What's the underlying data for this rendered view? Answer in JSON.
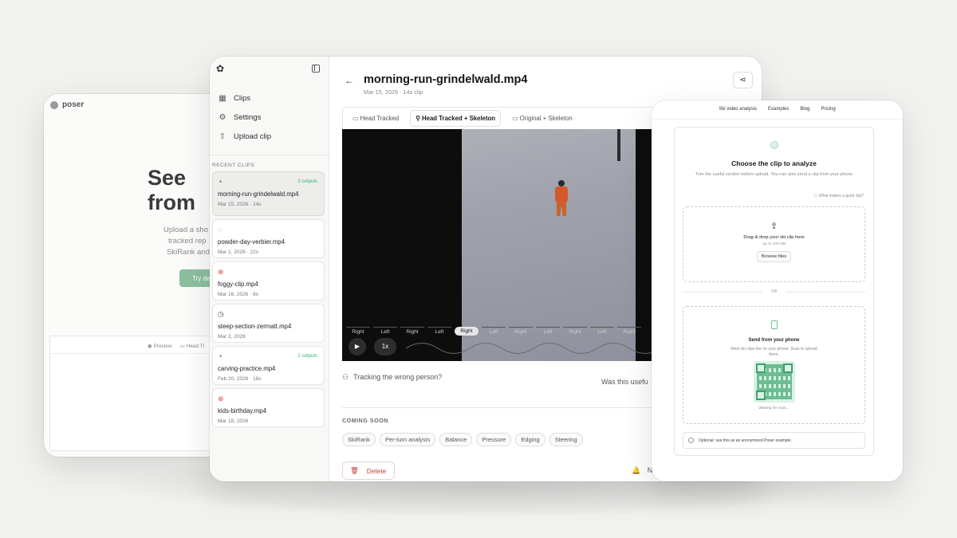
{
  "back_page": {
    "brand": "poser",
    "hero_line1": "See",
    "hero_line2": "from",
    "sub_line1": "Upload a sho",
    "sub_line2": "tracked rep",
    "sub_line3": "SkiRank and",
    "cta": "Try de",
    "preview_tab1": "Preview",
    "preview_tab2": "Head Tr"
  },
  "sidebar": {
    "nav": [
      {
        "label": "Clips",
        "icon": "grid-icon"
      },
      {
        "label": "Settings",
        "icon": "gear-icon"
      },
      {
        "label": "Upload clip",
        "icon": "upload-icon"
      }
    ],
    "recent_title": "RECENT CLIPS",
    "clips": [
      {
        "name": "morning-run-grindelwald.mp4",
        "meta": "Mar 15, 2026 · 14s",
        "status": "done",
        "badge": "3 outputs"
      },
      {
        "name": "powder-day-verbier.mp4",
        "meta": "Mar 1, 2026 · 22s",
        "status": "loading",
        "badge": ""
      },
      {
        "name": "foggy-clip.mp4",
        "meta": "Mar 16, 2026 · 8s",
        "status": "error",
        "badge": ""
      },
      {
        "name": "steep-section-zermatt.mp4",
        "meta": "Mar 2, 2026",
        "status": "pending",
        "badge": ""
      },
      {
        "name": "carving-practice.mp4",
        "meta": "Feb 20, 2026 · 18s",
        "status": "done",
        "badge": "2 outputs"
      },
      {
        "name": "kids-birthday.mp4",
        "meta": "Mar 18, 2026",
        "status": "error",
        "badge": ""
      }
    ]
  },
  "main": {
    "title": "morning-run-grindelwald.mp4",
    "subtitle": "Mar 15, 2026 · 14s clip",
    "tabs": [
      "Head Tracked",
      "Head Tracked + Skeleton",
      "Original + Skeleton"
    ],
    "active_tab": 1,
    "timeline": [
      "Right",
      "Left",
      "Right",
      "Left",
      "Right",
      "Left",
      "Right",
      "Left",
      "Right",
      "Left",
      "Right"
    ],
    "active_tick": 4,
    "speed": "1x",
    "tracking_wrong": "Tracking the wrong person?",
    "was_useful": "Was this usefu",
    "coming_soon_title": "COMING SOON",
    "coming_soon": [
      "SkiRank",
      "Per-turn analysis",
      "Balance",
      "Pressure",
      "Edging",
      "Steering"
    ],
    "delete": "Delete",
    "notify": "N"
  },
  "upload_page": {
    "nav": [
      "Ski video analysis",
      "Examples",
      "Blog",
      "Pricing"
    ],
    "title": "Choose the clip to analyze",
    "desc": "Trim the useful section before upload. You can also send a clip from your phone.",
    "help": "What makes a good clip?",
    "drop_title": "Drag & drop your ski clip here",
    "drop_limit": "Up to 200 MB",
    "browse": "Browse files",
    "or": "OR",
    "phone_title": "Send from your phone",
    "phone_desc": "Most ski clips live on your phone. Scan to upload there.",
    "waiting": "Waiting for scan...",
    "optional": "Optional: use this as an anonymized Poser example."
  },
  "colors": {
    "accent": "#3ab37a",
    "error": "#d9534f",
    "background": "#f1f1ef"
  }
}
